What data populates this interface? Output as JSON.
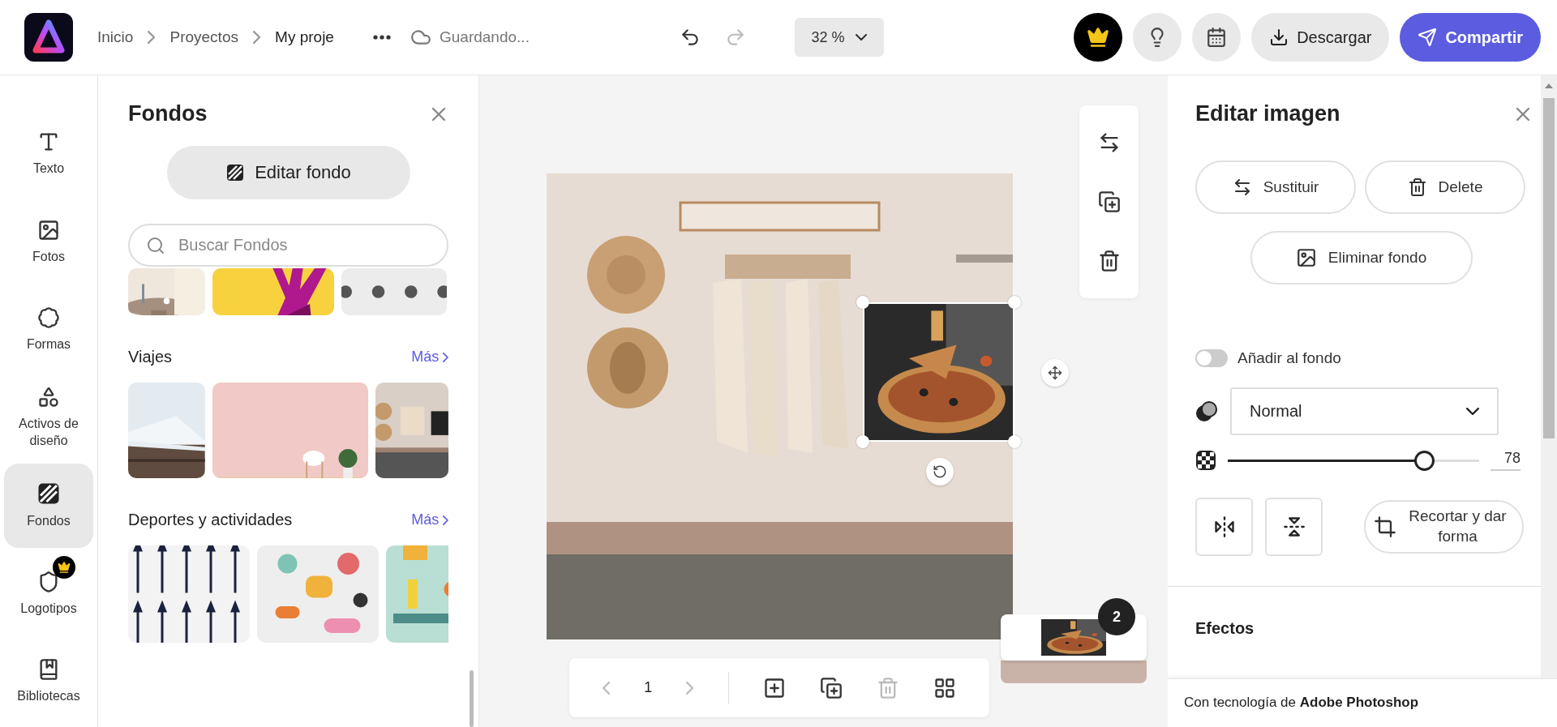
{
  "app_bar": {
    "breadcrumb": [
      {
        "label": "Inicio"
      },
      {
        "label": "Proyectos"
      },
      {
        "label": "My proje"
      }
    ],
    "status": "Guardando...",
    "undo": {
      "disabled": false
    },
    "redo": {
      "disabled": true
    },
    "zoom": "32 %",
    "download": "Descargar",
    "share": "Compartir"
  },
  "rail": [
    {
      "label": "Texto",
      "kind": "text",
      "selected": false,
      "premium": false
    },
    {
      "label": "Fotos",
      "kind": "photos",
      "selected": false,
      "premium": false
    },
    {
      "label": "Formas",
      "kind": "shapes",
      "selected": false,
      "premium": false
    },
    {
      "label": "Activos de diseño",
      "kind": "assets",
      "selected": false,
      "premium": false
    },
    {
      "label": "Fondos",
      "kind": "backgrounds",
      "selected": true,
      "premium": false
    },
    {
      "label": "Logotipos",
      "kind": "logos",
      "selected": false,
      "premium": true
    },
    {
      "label": "Bibliotecas",
      "kind": "libraries",
      "selected": false,
      "premium": false
    }
  ],
  "panel": {
    "title": "Fondos",
    "edit_button": "Editar fondo",
    "search": {
      "placeholder": "Buscar Fondos"
    },
    "sections": [
      {
        "tiles": [
          {
            "kind": "picture"
          },
          {
            "kind": "picture"
          },
          {
            "kind": "picture"
          }
        ]
      },
      {
        "title": "Viajes",
        "more": "Más",
        "tiles": [
          {
            "kind": "picture"
          },
          {
            "kind": "picture"
          },
          {
            "kind": "picture"
          }
        ]
      },
      {
        "title": "Deportes y actividades",
        "more": "Más",
        "tiles": [
          {
            "kind": "picture"
          },
          {
            "kind": "picture"
          },
          {
            "kind": "picture"
          }
        ]
      }
    ]
  },
  "canvas": {
    "page_number": "1",
    "page_badge": "2",
    "prev": {
      "disabled": true
    },
    "next": {
      "disabled": true
    },
    "delete_page": {
      "disabled": true
    }
  },
  "edit_panel": {
    "title": "Editar imagen",
    "actions": [
      {
        "label": "Sustituir",
        "kind": "replace"
      },
      {
        "label": "Delete",
        "kind": "delete"
      }
    ],
    "remove_bg": "Eliminar fondo",
    "add_to_bg": {
      "label": "Añadir al fondo",
      "on": false
    },
    "blend": {
      "value": "Normal"
    },
    "opacity": {
      "level": 0.78,
      "reading": "78"
    },
    "crop": "Recortar y dar forma",
    "section": "Efectos",
    "footer": "Con tecnología de **Adobe Photoshop**"
  }
}
